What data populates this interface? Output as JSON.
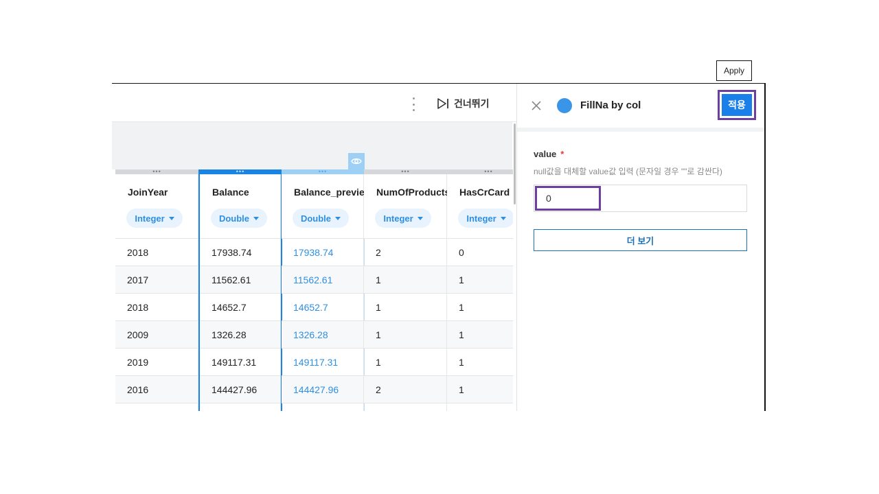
{
  "tooltip": {
    "label": "Apply"
  },
  "toolbar": {
    "skip_label": "건너뛰기"
  },
  "table": {
    "columns": [
      {
        "name": "JoinYear",
        "type": "Integer",
        "values": [
          "2018",
          "2017",
          "2018",
          "2009",
          "2019",
          "2016"
        ]
      },
      {
        "name": "Balance",
        "type": "Double",
        "values": [
          "17938.74",
          "11562.61",
          "14652.7",
          "1326.28",
          "149117.31",
          "144427.96"
        ]
      },
      {
        "name": "Balance_preview",
        "type": "Double",
        "values": [
          "17938.74",
          "11562.61",
          "14652.7",
          "1326.28",
          "149117.31",
          "144427.96"
        ]
      },
      {
        "name": "NumOfProducts",
        "type": "Integer",
        "values": [
          "2",
          "1",
          "1",
          "1",
          "1",
          "2"
        ]
      },
      {
        "name": "HasCrCard",
        "type": "Integer",
        "values": [
          "0",
          "1",
          "1",
          "1",
          "1",
          "1"
        ]
      }
    ]
  },
  "panel": {
    "title": "FillNa by col",
    "apply_label": "적용",
    "status_color": "#3a94e8",
    "field": {
      "label": "value",
      "required_mark": "*",
      "help": "null값을 대체할 value값 입력 (문자일 경우 \"\"로 감싼다)",
      "value": "0"
    },
    "more_label": "더 보기"
  },
  "colors": {
    "accent": "#1a7fe8",
    "highlight": "#6b3fa0",
    "preview": "#9ed0f5"
  }
}
